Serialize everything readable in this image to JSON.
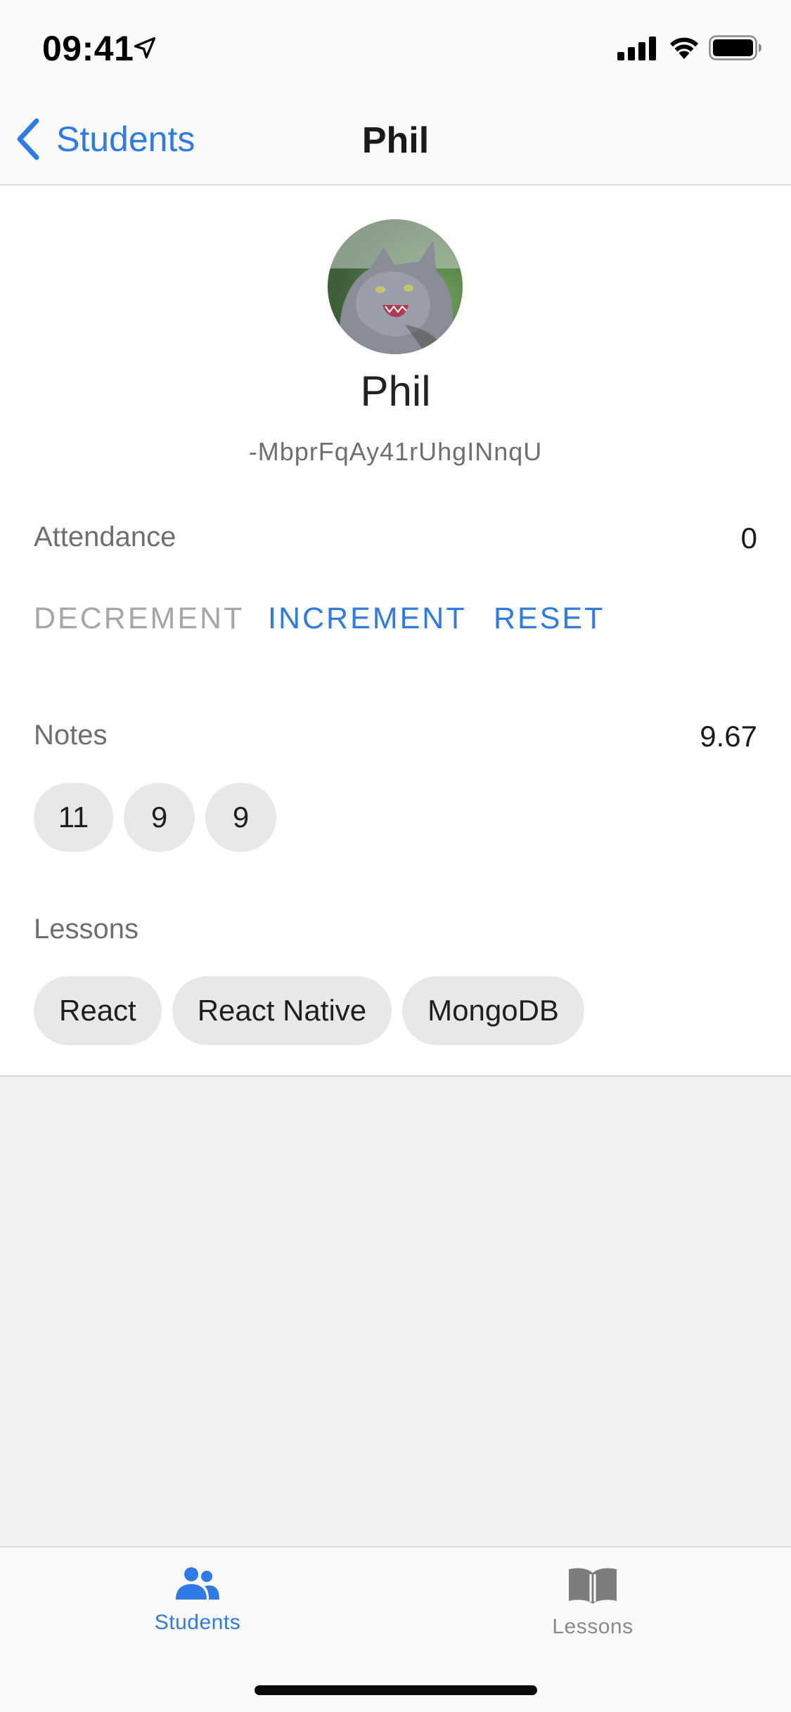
{
  "status_bar": {
    "time": "09:41"
  },
  "nav": {
    "back_label": "Students",
    "title": "Phil"
  },
  "profile": {
    "name": "Phil",
    "id": "-MbprFqAy41rUhgINnqU"
  },
  "attendance": {
    "label": "Attendance",
    "value": "0",
    "actions": {
      "decrement": "DECREMENT",
      "increment": "INCREMENT",
      "reset": "RESET"
    }
  },
  "notes": {
    "label": "Notes",
    "average": "9.67",
    "items": [
      "11",
      "9",
      "9"
    ]
  },
  "lessons": {
    "label": "Lessons",
    "items": [
      "React",
      "React Native",
      "MongoDB"
    ]
  },
  "tabs": [
    {
      "label": "Students",
      "icon": "people-icon",
      "active": true
    },
    {
      "label": "Lessons",
      "icon": "book-icon",
      "active": false
    }
  ],
  "colors": {
    "accent": "#2e7be6",
    "disabled": "#a6a6a6",
    "chip_bg": "#e8e8e8",
    "page_bg": "#f1f1f1"
  }
}
